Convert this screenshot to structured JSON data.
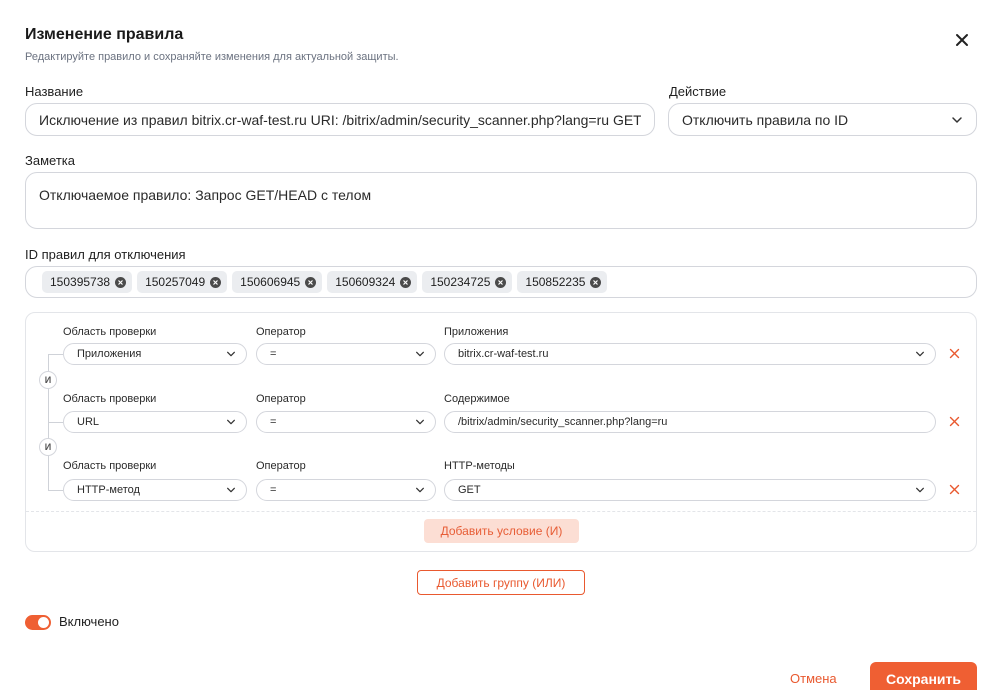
{
  "dialog": {
    "title": "Изменение правила",
    "subtitle": "Редактируйте правило и сохраняйте изменения для актуальной защиты.",
    "close_icon": "close-icon"
  },
  "name_field": {
    "label": "Название",
    "value": "Исключение из правил bitrix.cr-waf-test.ru URI: /bitrix/admin/security_scanner.php?lang=ru GET"
  },
  "action_field": {
    "label": "Действие",
    "value": "Отключить правила по ID"
  },
  "note_field": {
    "label": "Заметка",
    "value": "Отключаемое правило: Запрос GET/HEAD с телом"
  },
  "rule_ids": {
    "label": "ID правил для отключения",
    "tags": [
      "150395738",
      "150257049",
      "150606945",
      "150609324",
      "150234725",
      "150852235"
    ]
  },
  "conditions": [
    {
      "scope_label": "Область проверки",
      "scope": "Приложения",
      "operator_label": "Оператор",
      "operator": "=",
      "value_label": "Приложения",
      "value": "bitrix.cr-waf-test.ru",
      "value_is_select": true
    },
    {
      "scope_label": "Область проверки",
      "scope": "URL",
      "operator_label": "Оператор",
      "operator": "=",
      "value_label": "Содержимое",
      "value": "/bitrix/admin/security_scanner.php?lang=ru",
      "value_is_select": false
    },
    {
      "scope_label": "Область проверки",
      "scope": "HTTP-метод",
      "operator_label": "Оператор",
      "operator": "=",
      "value_label": "HTTP-методы",
      "value": "GET",
      "value_is_select": true
    }
  ],
  "and_label": "И",
  "add_condition_label": "Добавить условие (И)",
  "add_group_label": "Добавить группу (ИЛИ)",
  "enabled": {
    "label": "Включено",
    "on": true
  },
  "footer": {
    "cancel_label": "Отмена",
    "save_label": "Сохранить"
  },
  "colors": {
    "accent": "#ef5f33",
    "accent_soft": "#fcded4",
    "border": "#d4d6dc"
  }
}
